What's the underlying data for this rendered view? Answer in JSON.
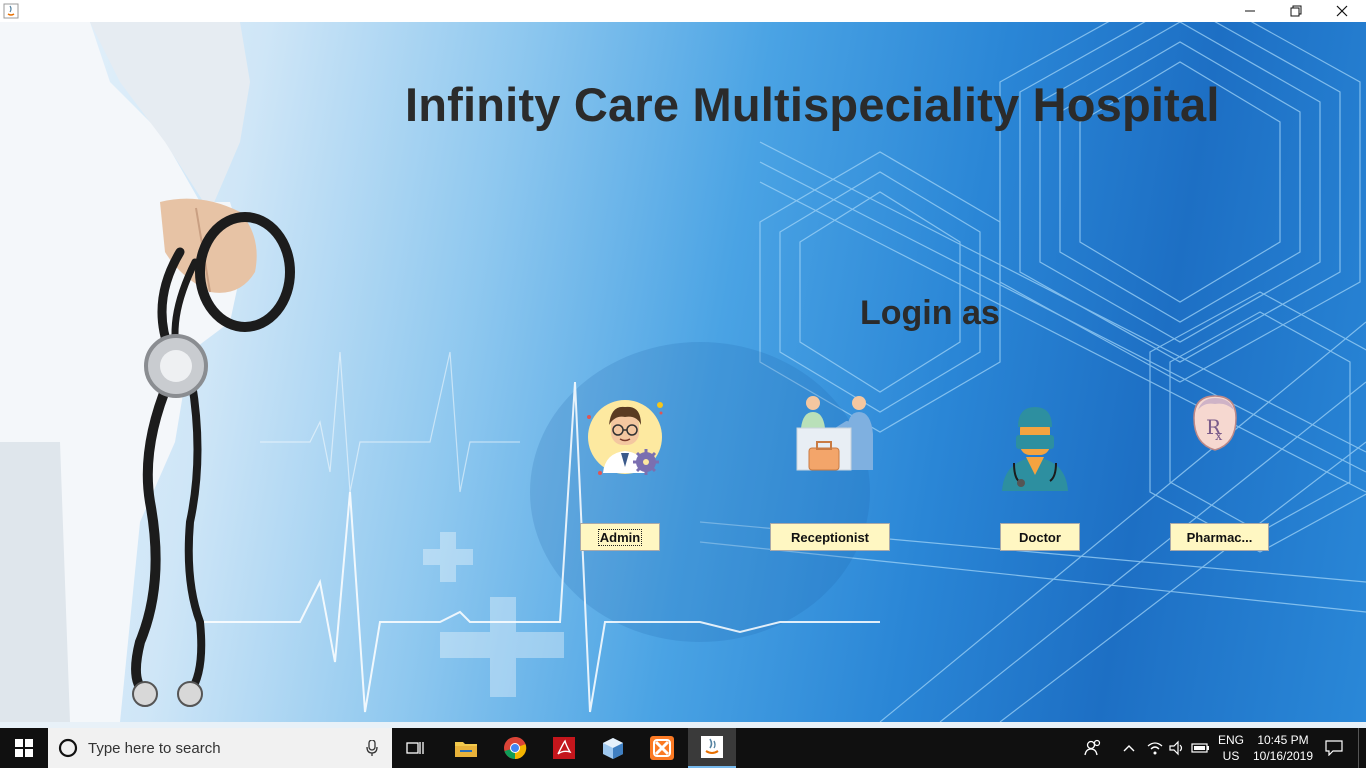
{
  "header": {
    "title": "Infinity Care Multispeciality Hospital",
    "subtitle": "Login as"
  },
  "roles": [
    {
      "label": "Admin",
      "icon": "admin-avatar-icon"
    },
    {
      "label": "Receptionist",
      "icon": "receptionist-icon"
    },
    {
      "label": "Doctor",
      "icon": "doctor-icon"
    },
    {
      "label": "Pharmac...",
      "icon": "pharmacist-rx-icon"
    }
  ],
  "taskbar": {
    "search_placeholder": "Type here to search",
    "language": "ENG",
    "region": "US",
    "time": "10:45 PM",
    "date": "10/16/2019"
  },
  "colors": {
    "button_bg": "#fff7c2",
    "title_text": "#2b2b2b",
    "taskbar": "#101010"
  }
}
